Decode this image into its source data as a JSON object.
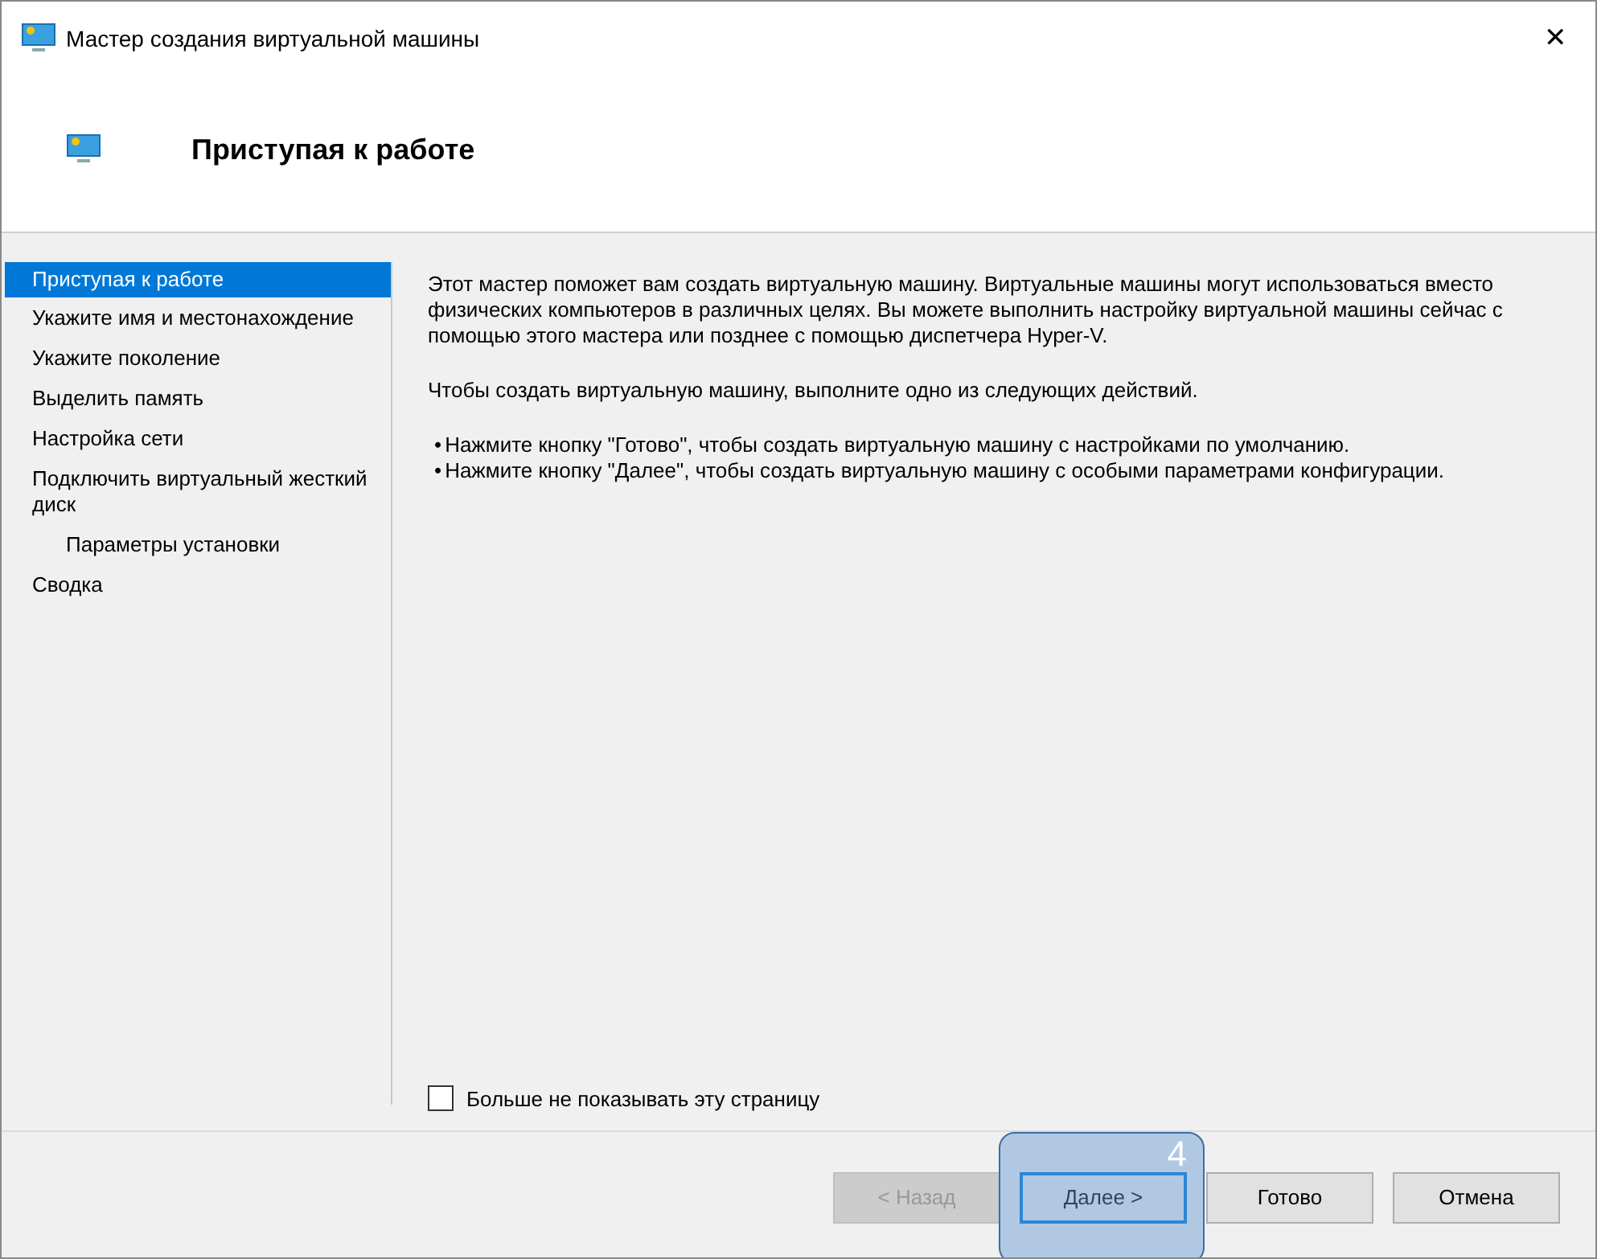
{
  "window": {
    "title": "Мастер создания виртуальной машины",
    "close": "✕"
  },
  "header": {
    "title": "Приступая к работе"
  },
  "steps": [
    {
      "label": "Приступая к работе",
      "selected": true
    },
    {
      "label": "Укажите имя и местонахождение",
      "selected": false
    },
    {
      "label": "Укажите поколение",
      "selected": false
    },
    {
      "label": "Выделить память",
      "selected": false
    },
    {
      "label": "Настройка сети",
      "selected": false
    },
    {
      "label": "Подключить виртуальный жесткий диск",
      "selected": false,
      "children": [
        {
          "label": "Параметры установки",
          "selected": false
        }
      ]
    },
    {
      "label": "Сводка",
      "selected": false
    }
  ],
  "content": {
    "paragraphs": [
      "Этот мастер поможет вам создать виртуальную машину. Виртуальные машины могут использоваться вместо физических компьютеров в различных целях. Вы можете выполнить настройку виртуальной машины сейчас с помощью этого мастера или позднее с помощью диспетчера Hyper-V.",
      "Чтобы создать виртуальную машину, выполните одно из следующих действий."
    ],
    "bullets": [
      {
        "marker": "•",
        "text": "Нажмите кнопку \"Готово\", чтобы создать виртуальную машину с настройками по умолчанию."
      },
      {
        "marker": "•",
        "text": "Нажмите кнопку \"Далее\", чтобы создать виртуальную машину с особыми параметрами конфигурации."
      }
    ],
    "checkbox": {
      "label": "Больше не показывать эту страницу",
      "checked": false
    }
  },
  "buttons": [
    {
      "label": "< Назад",
      "disabled": true,
      "focused": false
    },
    {
      "label": "Далее >",
      "disabled": false,
      "focused": true,
      "callout": "4"
    },
    {
      "label": "Готово",
      "disabled": false,
      "focused": false
    },
    {
      "label": "Отмена",
      "disabled": false,
      "focused": false
    }
  ]
}
